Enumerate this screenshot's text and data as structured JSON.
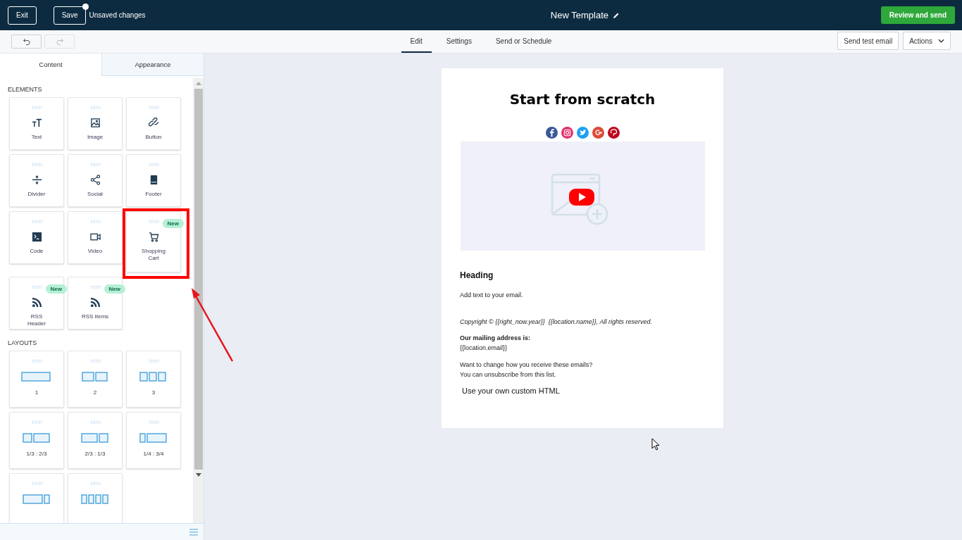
{
  "topbar": {
    "exit_button": "Exit",
    "save_button": {
      "label": "Save",
      "unsaved_dot": true
    },
    "status": "Unsaved changes",
    "title": "New Template",
    "primary_button": "Review and send"
  },
  "toolbar": {
    "undo": {
      "disabled": false
    },
    "redo": {
      "disabled": true
    },
    "tabs": [
      {
        "label": "Edit",
        "selected": true
      },
      {
        "label": "Settings",
        "selected": false
      },
      {
        "label": "Send or Schedule",
        "selected": false
      }
    ],
    "test_button": "Send test email",
    "actions_button": "Actions"
  },
  "panel": {
    "tabs": [
      {
        "label": "Content",
        "selected": true
      },
      {
        "label": "Appearance",
        "selected": false
      }
    ],
    "elements_heading": "ELEMENTS",
    "elements": [
      {
        "kind": "text",
        "label": "Text",
        "new": false,
        "highlighted": false
      },
      {
        "kind": "image",
        "label": "Image",
        "new": false,
        "highlighted": false
      },
      {
        "kind": "link",
        "label": "Button",
        "new": false,
        "highlighted": false
      },
      {
        "kind": "divider",
        "label": "Divider",
        "new": false,
        "highlighted": false
      },
      {
        "kind": "social",
        "label": "Social",
        "new": false,
        "highlighted": false
      },
      {
        "kind": "footer",
        "label": "Footer",
        "new": false,
        "highlighted": false
      },
      {
        "kind": "code",
        "label": "Code",
        "new": false,
        "highlighted": false
      },
      {
        "kind": "video",
        "label": "Video",
        "new": false,
        "highlighted": false
      },
      {
        "kind": "cart",
        "label": "Shopping Cart",
        "new": true,
        "badge": "New",
        "highlighted": true
      },
      {
        "kind": "rss",
        "label": "RSS Header",
        "new": true,
        "badge": "New",
        "highlighted": false
      },
      {
        "kind": "rss",
        "label": "RSS Items",
        "new": true,
        "badge": "New",
        "highlighted": false
      }
    ],
    "layouts_heading": "LAYOUTS",
    "layouts": [
      {
        "kind": "one",
        "label": "1"
      },
      {
        "kind": "two",
        "label": "2"
      },
      {
        "kind": "three",
        "label": "3"
      },
      {
        "kind": "third-twothirds",
        "label": "1/3 : 2/3"
      },
      {
        "kind": "twothirds-third",
        "label": "2/3 : 1/3"
      },
      {
        "kind": "quarter-threequarters",
        "label": "1/4 : 3/4"
      },
      {
        "kind": "threequarters-quarter"
      },
      {
        "kind": "four"
      }
    ]
  },
  "email": {
    "title": "Start from scratch",
    "social": [
      {
        "kind": "f",
        "color": "#3b5998"
      },
      {
        "kind": "camera",
        "color": "#e1306c"
      },
      {
        "kind": "bird",
        "color": "#1da1f2"
      },
      {
        "kind": "g",
        "color": "#dd4b39"
      },
      {
        "kind": "p",
        "color": "#bd081c"
      }
    ],
    "heading": "Heading",
    "body": "Add text to your email.",
    "copyright": "Copyright © {{right_now.year}}  {{location.name}}, All rights reserved.",
    "address_label": "Our mailing address is:",
    "address": "{{location.email}}",
    "unsubscribe_lines": [
      "Want to change how you receive these emails?",
      "You can unsubscribe from this list."
    ],
    "custom_html": "Use your own custom HTML"
  }
}
